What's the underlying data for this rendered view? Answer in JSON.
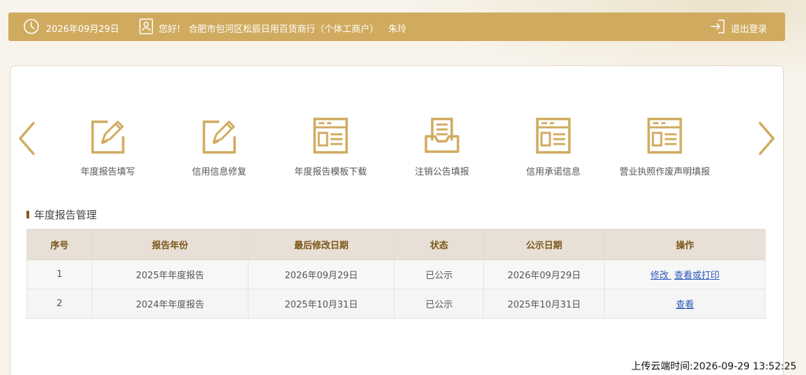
{
  "topbar": {
    "date": "2026年09月29日",
    "greeting": "您好!",
    "company": "合肥市包河区松辰日用百货商行（个体工商户）",
    "person": "朱玲",
    "logout": "退出登录"
  },
  "colors": {
    "accent": "#d0ab5f",
    "header_text": "#7a5618",
    "link": "#2a57b8"
  },
  "functions": [
    {
      "label": "年度报告填写",
      "icon": "edit-form-icon"
    },
    {
      "label": "信用信息修复",
      "icon": "edit-form-icon"
    },
    {
      "label": "年度报告模板下载",
      "icon": "template-doc-icon"
    },
    {
      "label": "注销公告填报",
      "icon": "inbox-tray-icon"
    },
    {
      "label": "信用承诺信息",
      "icon": "template-doc-icon"
    },
    {
      "label": "营业执照作废声明填报",
      "icon": "template-doc-icon"
    }
  ],
  "section": {
    "title": "年度报告管理"
  },
  "table": {
    "headers": [
      "序号",
      "报告年份",
      "最后修改日期",
      "状态",
      "公示日期",
      "操作"
    ],
    "rows": [
      {
        "no": "1",
        "year": "2025年年度报告",
        "modified": "2026年09月29日",
        "status": "已公示",
        "publish": "2026年09月29日",
        "action1": "修改",
        "action2": "查看或打印"
      },
      {
        "no": "2",
        "year": "2024年年度报告",
        "modified": "2025年10月31日",
        "status": "已公示",
        "publish": "2025年10月31日",
        "action1": "查看"
      }
    ]
  },
  "footer": {
    "upload_time": "上传云端时间:2026-09-29 13:52:25"
  }
}
